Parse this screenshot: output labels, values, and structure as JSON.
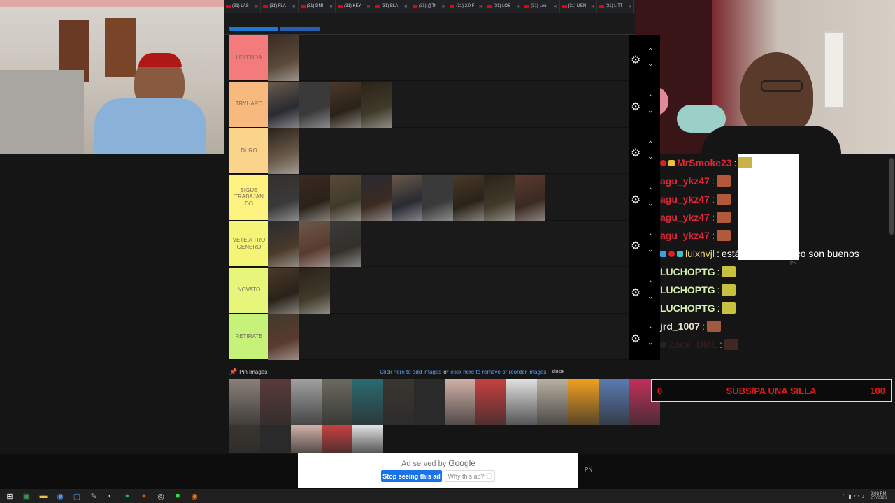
{
  "browser": {
    "tabs": [
      "(31) LAS",
      "(31) FLA",
      "(31) DMI",
      "(31) KEY",
      "(31) BLA",
      "(31) @Th",
      "(31) 2.0 F",
      "(31) LOS",
      "(31) Leo",
      "(31) MEN",
      "(31) LITT"
    ]
  },
  "tierlist": {
    "tiers": [
      {
        "label": "LEYENDA",
        "color": "#f47b7b",
        "items": 1
      },
      {
        "label": "TRYHARD",
        "color": "#f8b97e",
        "items": 4
      },
      {
        "label": "DURO",
        "color": "#f9d48a",
        "items": 1
      },
      {
        "label": "SIGUE TRABAJAN DO",
        "color": "#fdf27f",
        "items": 9
      },
      {
        "label": "VETE A TRO GENERO",
        "color": "#f4f476",
        "items": 3
      },
      {
        "label": "NOVATO",
        "color": "#e7f57a",
        "items": 2
      },
      {
        "label": "RETIRATE",
        "color": "#c7f27a",
        "items": 1
      }
    ],
    "gear_icon": "gear-icon"
  },
  "chat": {
    "messages": [
      {
        "user": "MrSmoke23",
        "user_color": "#e0263a",
        "text": ""
      },
      {
        "user": "agu_ykz47",
        "user_color": "#e0263a",
        "text": ""
      },
      {
        "user": "agu_ykz47",
        "user_color": "#e0263a",
        "text": ""
      },
      {
        "user": "agu_ykz47",
        "user_color": "#e0263a",
        "text": ""
      },
      {
        "user": "agu_ykz47",
        "user_color": "#e0263a",
        "text": ""
      },
      {
        "user": "luixnvjl",
        "user_color": "#e8d27a",
        "text": "estás loco tampoco son buenos"
      },
      {
        "user": "LUCHOPTG",
        "user_color": "#d6f0b0",
        "text": ""
      },
      {
        "user": "LUCHOPTG",
        "user_color": "#d6f0b0",
        "text": ""
      },
      {
        "user": "LUCHOPTG",
        "user_color": "#d6f0b0",
        "text": ""
      },
      {
        "user": "jrd_1007",
        "user_color": "#e8e0d0",
        "text": ""
      },
      {
        "user": "Zack_DML",
        "user_color": "#5a2020",
        "text": ""
      }
    ],
    "separator": ":",
    "overlay_tag": "PN"
  },
  "pin": {
    "label": "Pin Images",
    "add_link": "Click here to add images",
    "or": "or",
    "remove_link": "click here to remove or reorder images.",
    "close": "close"
  },
  "goal": {
    "left": "0",
    "label": "SUBS/PA UNA SILLA",
    "right": "100",
    "progress_fraction": 0
  },
  "ad": {
    "served_by": "Ad served by",
    "google": "Google",
    "stop_button": "Stop seeing this ad",
    "why_button": "Why this ad?",
    "tag": "PN"
  },
  "taskbar": {
    "time": "8:08 PM",
    "date": "2/7/2026"
  }
}
